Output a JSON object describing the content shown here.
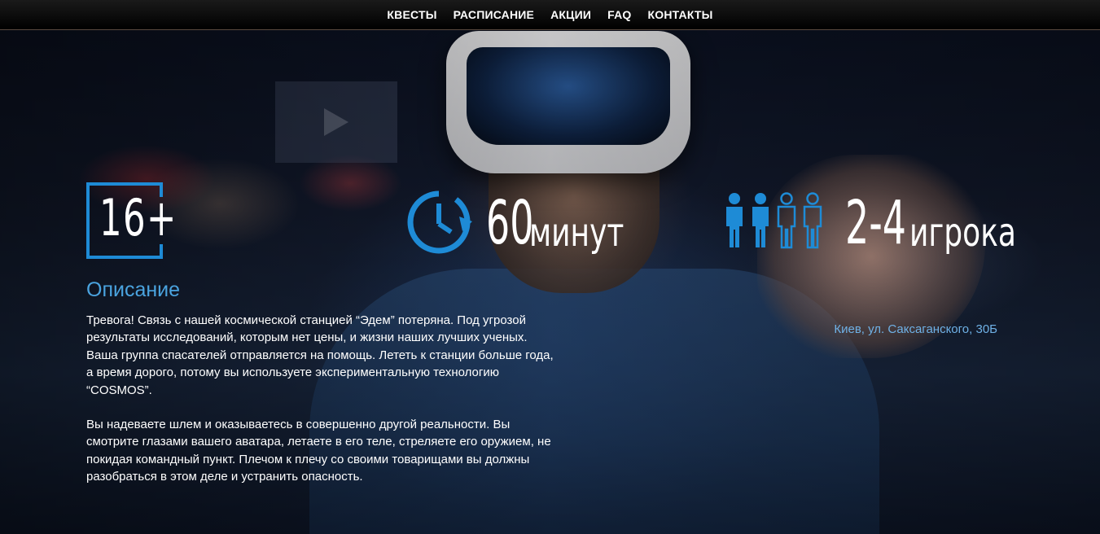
{
  "nav": {
    "items": [
      {
        "label": "КВЕСТЫ"
      },
      {
        "label": "РАСПИСАНИЕ"
      },
      {
        "label": "АКЦИИ"
      },
      {
        "label": "FAQ"
      },
      {
        "label": "КОНТАКТЫ"
      }
    ]
  },
  "stats": {
    "age": "16+",
    "duration_value": "60",
    "duration_unit": "минут",
    "players_value": "2-4",
    "players_unit": "игрока"
  },
  "description": {
    "title": "Описание",
    "paragraph1": "Тревога! Связь с нашей космической станцией “Эдем” потеряна. Под угрозой результаты исследований, которым нет цены, и жизни наших лучших ученых. Ваша группа спасателей отправляется на помощь. Лететь к станции больше года, а время дорого, потому вы используете экспериментальную технологию “COSMOS”.",
    "paragraph2": "Вы надеваете шлем и оказываетесь в совершенно другой реальности. Вы смотрите глазами вашего аватара, летаете в его теле, стреляете его оружием, не покидая командный пункт. Плечом к плечу со своими товарищами вы должны разобраться в этом деле и устранить опасность."
  },
  "address": "Киев, ул. Саксаганского, 30Б",
  "colors": {
    "accent": "#1e8bd6",
    "title_blue": "#4aa3df",
    "address_blue": "#6fb1e6",
    "nav_bg": "#000000"
  },
  "icons": {
    "age": "age-rating-frame",
    "duration": "clock-icon",
    "players": "people-icon"
  }
}
